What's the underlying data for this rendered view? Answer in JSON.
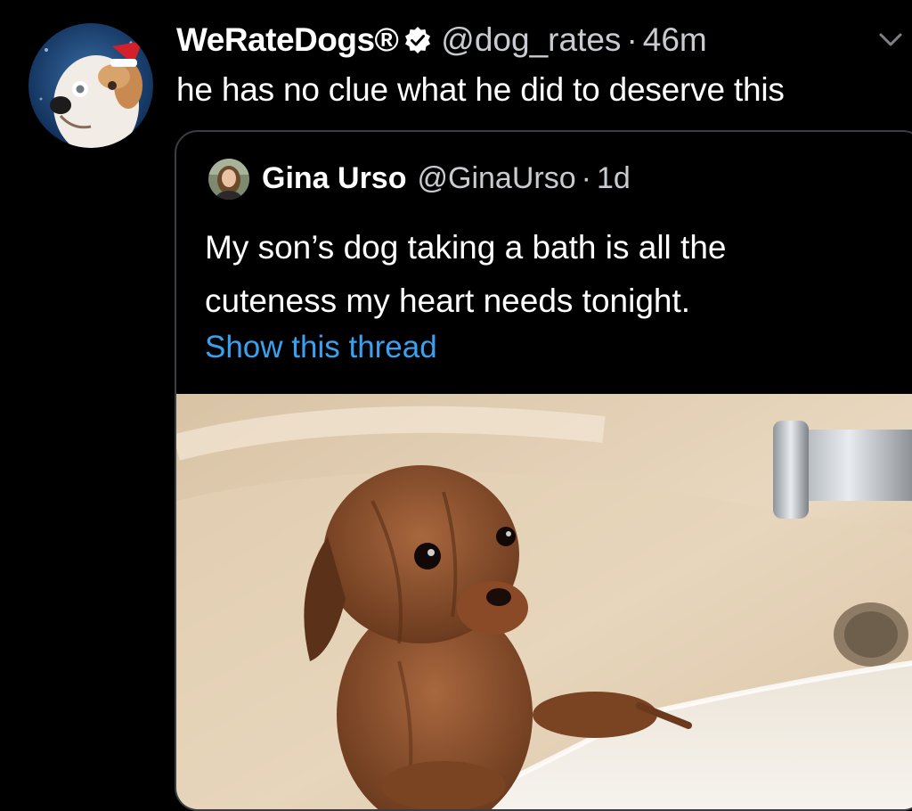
{
  "tweet": {
    "display_name": "WeRateDogs®",
    "handle": "@dog_rates",
    "separator": "·",
    "time": "46m",
    "text": "he has no clue what he did to deserve this",
    "avatar_icon": "dog-avatar-icon",
    "verified_icon": "verified-badge-icon",
    "menu_icon": "chevron-down-icon"
  },
  "quoted_tweet": {
    "display_name": "Gina Urso",
    "handle": "@GinaUrso",
    "separator": "·",
    "time": "1d",
    "text_lines": [
      "My son’s dog taking a bath is all the",
      "cuteness my heart needs tonight."
    ],
    "show_thread": "Show this thread",
    "avatar_icon": "user-avatar-icon",
    "media_icon": "photo-wet-puppy-in-bathtub"
  },
  "colors": {
    "background": "#000000",
    "text_primary": "#ffffff",
    "text_secondary": "#c8ccd0",
    "link": "#3aa0f0",
    "card_border": "#3a3d41"
  }
}
